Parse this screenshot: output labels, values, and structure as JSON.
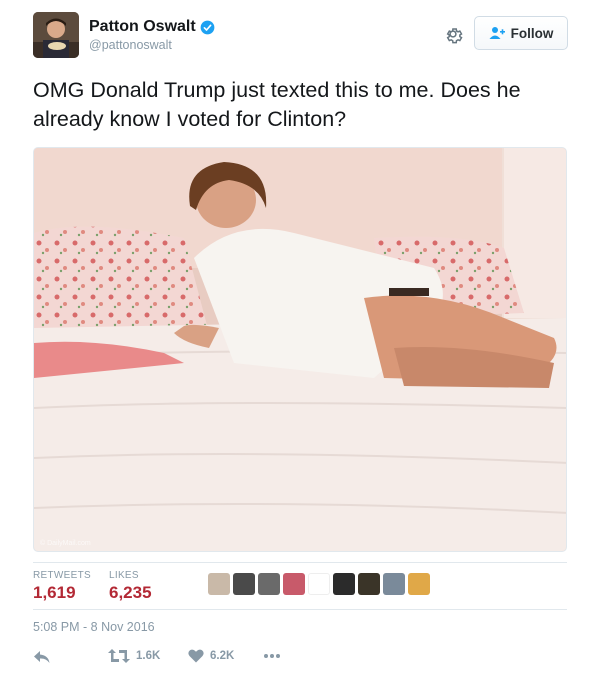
{
  "header": {
    "display_name": "Patton Oswalt",
    "handle": "@pattonoswalt",
    "follow_label": "Follow"
  },
  "tweet": {
    "text": "OMG Donald Trump just texted this to me. Does he already know I voted for Clinton?"
  },
  "photo": {
    "watermark": "© DailyMail.com"
  },
  "stats": {
    "retweets_label": "RETWEETS",
    "retweets_value": "1,619",
    "likes_label": "LIKES",
    "likes_value": "6,235"
  },
  "timestamp": "5:08 PM - 8 Nov 2016",
  "actions": {
    "retweet_count": "1.6K",
    "like_count": "6.2K"
  },
  "icons": [
    "verified-icon",
    "gear-icon",
    "follow-user-icon",
    "reply-icon",
    "retweet-icon",
    "heart-icon",
    "more-icon"
  ],
  "colors": {
    "accent": "#1da1f2",
    "stat_value": "#b32935",
    "muted": "#8899a6"
  }
}
